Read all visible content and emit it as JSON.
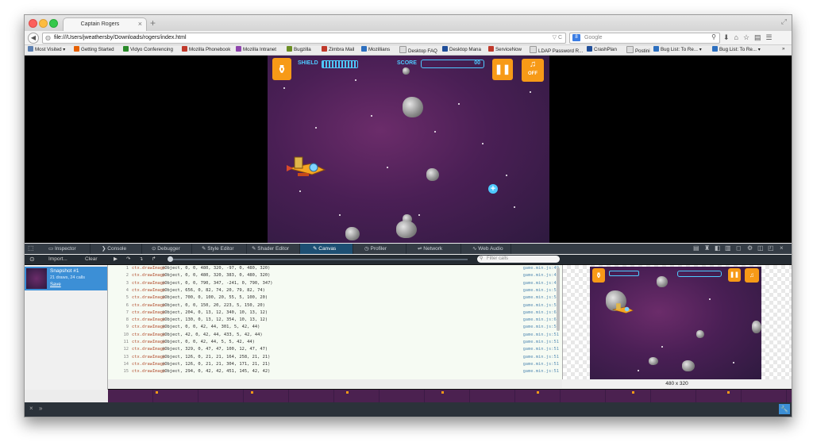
{
  "browser": {
    "tab_title": "Captain Rogers",
    "tab_close": "×",
    "new_tab": "+",
    "url": "file:///Users/jweathersby/Downloads/rogers/index.html",
    "url_actions": "▽ C",
    "search_placeholder": "Google",
    "search_engine": "8"
  },
  "bookmarks": [
    {
      "label": "Most Visited ▾",
      "color": "#5b7fb0"
    },
    {
      "label": "Getting Started",
      "color": "#e66000"
    },
    {
      "label": "Vidyo Conferencing",
      "color": "#2a8a2a"
    },
    {
      "label": "Mozilla Phonebook",
      "color": "#c0392b"
    },
    {
      "label": "Mozilla Intranet",
      "color": "#8e44ad"
    },
    {
      "label": "Bugzilla",
      "color": "#6b8e23"
    },
    {
      "label": "Zimbra Mail",
      "color": "#c0392b"
    },
    {
      "label": "Mozillians",
      "color": "#2c6fbf"
    },
    {
      "label": "Desktop FAQ",
      "color": "#dddddd"
    },
    {
      "label": "Desktop Mana",
      "color": "#1f4e99"
    },
    {
      "label": "ServiceNow",
      "color": "#c0392b"
    },
    {
      "label": "LDAP Password R...",
      "color": "#dddddd"
    },
    {
      "label": "CrashPlan",
      "color": "#1f4e99"
    },
    {
      "label": "Postini",
      "color": "#dddddd"
    },
    {
      "label": "Bug List: To Re... ▾",
      "color": "#2c6fbf"
    },
    {
      "label": "Bug List: To Re... ▾",
      "color": "#2c6fbf"
    }
  ],
  "game": {
    "shield_label": "SHIELD",
    "score_label": "SCORE",
    "score_value": "00",
    "pause_icon": "❚❚",
    "music_label": "OFF",
    "music_icon": "♫"
  },
  "devtools": {
    "tabs": [
      "Inspector",
      "Console",
      "Debugger",
      "Style Editor",
      "Shader Editor",
      "Canvas",
      "Profiler",
      "Network",
      "Web Audio"
    ],
    "active_tab": "Canvas",
    "import_label": "Import...",
    "clear_label": "Clear",
    "filter_placeholder": "Filter calls",
    "snapshot": {
      "title": "Snapshot #1",
      "subtitle": "21 draws, 24 calls",
      "save_label": "Save"
    },
    "calls": [
      {
        "n": "1",
        "fn": "ctx.drawImage",
        "args": "(Object, 0, 0, 480, 320, -97, 0, 480, 320)",
        "src": "game.min.js:49"
      },
      {
        "n": "2",
        "fn": "ctx.drawImage",
        "args": "(Object, 0, 0, 480, 320, 383, 0, 480, 320)",
        "src": "game.min.js:49"
      },
      {
        "n": "3",
        "fn": "ctx.drawImage",
        "args": "(Object, 0, 0, 790, 347, -241, 0, 790, 347)",
        "src": "game.min.js:49"
      },
      {
        "n": "4",
        "fn": "ctx.drawImage",
        "args": "(Object, 656, 0, 82, 74, 20, 79, 82, 74)",
        "src": "game.min.js:51"
      },
      {
        "n": "5",
        "fn": "ctx.drawImage",
        "args": "(Object, 700, 0, 100, 20, 55, 5, 100, 20)",
        "src": "game.min.js:51"
      },
      {
        "n": "6",
        "fn": "ctx.drawImage",
        "args": "(Object, 0, 0, 150, 20, 223, 5, 150, 20)",
        "src": "game.min.js:51"
      },
      {
        "n": "7",
        "fn": "ctx.drawImage",
        "args": "(Object, 204, 0, 13, 12, 340, 10, 13, 12)",
        "src": "game.min.js:66"
      },
      {
        "n": "8",
        "fn": "ctx.drawImage",
        "args": "(Object, 130, 0, 13, 12, 354, 10, 13, 12)",
        "src": "game.min.js:66"
      },
      {
        "n": "9",
        "fn": "ctx.drawImage",
        "args": "(Object, 0, 0, 42, 44, 301, 5, 42, 44)",
        "src": "game.min.js:51"
      },
      {
        "n": "10",
        "fn": "ctx.drawImage",
        "args": "(Object, 42, 0, 42, 44, 433, 5, 42, 44)",
        "src": "game.min.js:51"
      },
      {
        "n": "11",
        "fn": "ctx.drawImage",
        "args": "(Object, 0, 0, 42, 44, 5, 5, 42, 44)",
        "src": "game.min.js:51"
      },
      {
        "n": "12",
        "fn": "ctx.drawImage",
        "args": "(Object, 329, 0, 47, 47, 100, 12, 47, 47)",
        "src": "game.min.js:51"
      },
      {
        "n": "13",
        "fn": "ctx.drawImage",
        "args": "(Object, 126, 0, 21, 21, 164, 258, 21, 21)",
        "src": "game.min.js:51"
      },
      {
        "n": "14",
        "fn": "ctx.drawImage",
        "args": "(Object, 126, 0, 21, 21, 304, 171, 21, 21)",
        "src": "game.min.js:51"
      },
      {
        "n": "15",
        "fn": "ctx.drawImage",
        "args": "(Object, 294, 0, 42, 42, 451, 145, 42, 42)",
        "src": "game.min.js:51"
      }
    ],
    "preview_size": "480 x 320",
    "console_prompt": "»"
  },
  "colors": {
    "accent": "#3c8fd6",
    "hud_orange": "#f79a17",
    "hud_blue": "#4ec9ff",
    "space_purple": "#4a1f55"
  }
}
